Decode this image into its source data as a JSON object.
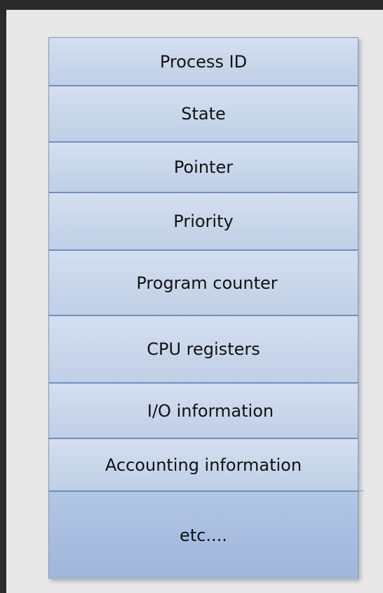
{
  "diagram": {
    "fields": [
      "Process ID",
      "State",
      "Pointer",
      "Priority",
      "Program counter",
      "CPU registers",
      "I/O information",
      "Accounting information",
      "etc...."
    ]
  }
}
